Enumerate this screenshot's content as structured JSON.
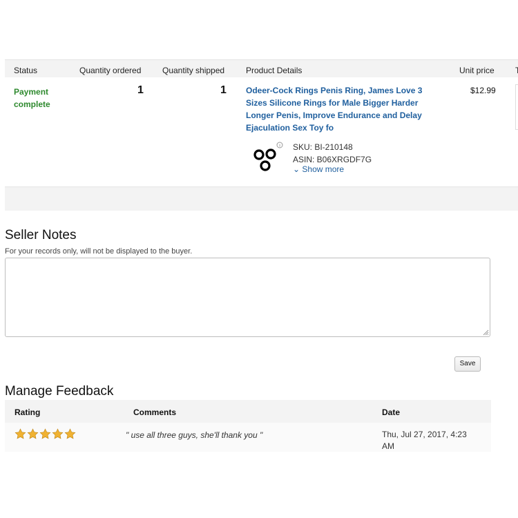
{
  "order": {
    "columns": [
      "Status",
      "Quantity ordered",
      "Quantity shipped",
      "Product Details",
      "Unit price",
      "T"
    ],
    "status": "Payment complete",
    "quantity_ordered": "1",
    "quantity_shipped": "1",
    "product_title": "Odeer-Cock Rings Penis Ring, James Love 3 Sizes Silicone Rings for Male Bigger Harder Longer Penis, Improve Endurance and Delay Ejaculation Sex Toy fo",
    "sku": "SKU: BI-210148",
    "asin": "ASIN: B06XRGDF7G",
    "show_more": "Show more",
    "unit_price": "$12.99"
  },
  "seller_notes": {
    "title": "Seller Notes",
    "subtitle": "For your records only, will not be displayed to the buyer.",
    "value": "",
    "save_label": "Save"
  },
  "feedback": {
    "title": "Manage Feedback",
    "columns": [
      "Rating",
      "Comments",
      "Date"
    ],
    "rating": 5,
    "comment": "\" use all three guys, she'll thank you \"",
    "date": "Thu, Jul 27, 2017, 4:23 AM"
  },
  "colors": {
    "status_green": "#2f8a2f",
    "link_blue": "#1f5f9e",
    "star_gold": "#f0b232"
  },
  "icons": {
    "product_thumbnail": "three-rings-image",
    "star": "star-icon",
    "resize": "resize-grip-icon",
    "info": "info-icon",
    "chevron": "chevron-down-icon"
  }
}
